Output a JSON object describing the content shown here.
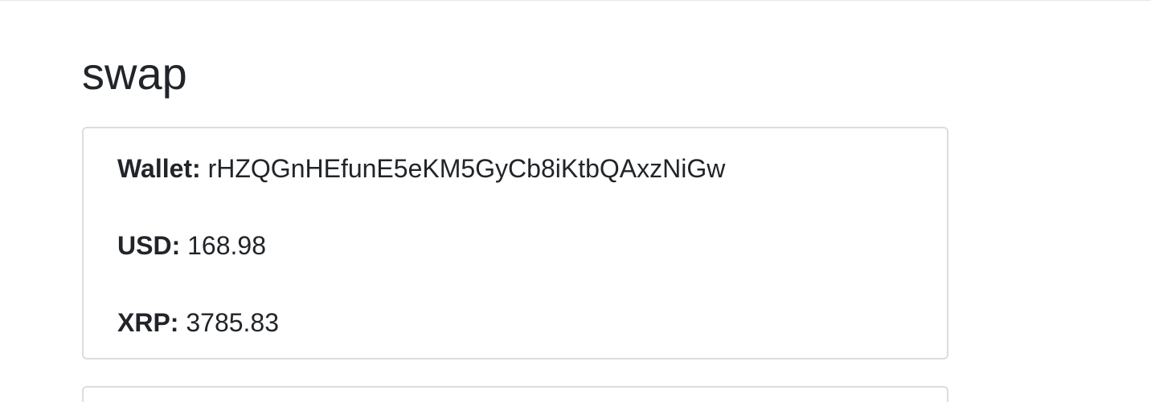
{
  "page": {
    "title": "swap"
  },
  "account": {
    "wallet_label": "Wallet:",
    "wallet_value": "rHZQGnHEfunE5eKM5GyCb8iKtbQAxzNiGw",
    "usd_label": "USD:",
    "usd_value": "168.98",
    "xrp_label": "XRP:",
    "xrp_value": "3785.83"
  },
  "colors": {
    "text": "#212529",
    "border": "#dcdcdc",
    "background": "#ffffff"
  }
}
